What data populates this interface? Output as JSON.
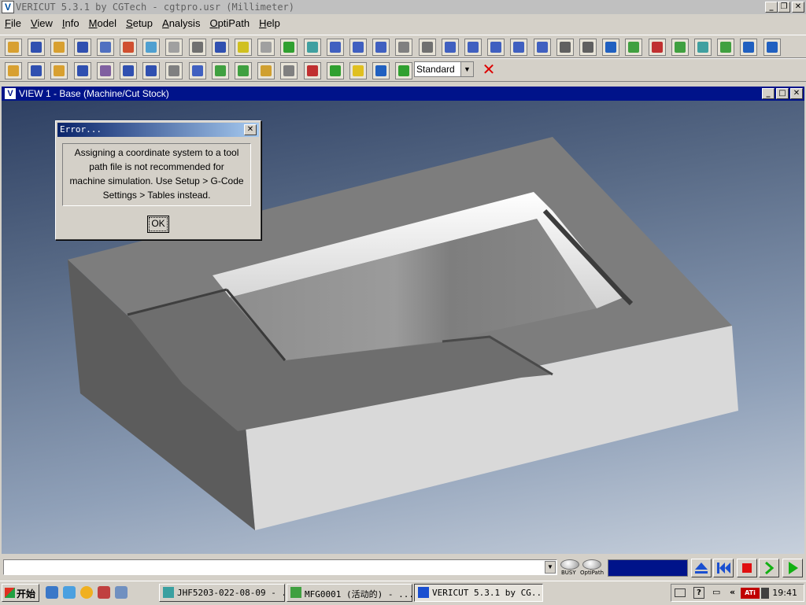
{
  "window": {
    "title": "VERICUT 5.3.1 by CGTech - cgtpro.usr (Millimeter)"
  },
  "menu": [
    {
      "pre": "",
      "u": "F",
      "post": "ile"
    },
    {
      "pre": "",
      "u": "V",
      "post": "iew"
    },
    {
      "pre": "",
      "u": "I",
      "post": "nfo"
    },
    {
      "pre": "",
      "u": "M",
      "post": "odel"
    },
    {
      "pre": "",
      "u": "S",
      "post": "etup"
    },
    {
      "pre": "",
      "u": "A",
      "post": "nalysis"
    },
    {
      "pre": "",
      "u": "O",
      "post": "ptiPath"
    },
    {
      "pre": "",
      "u": "H",
      "post": "elp"
    }
  ],
  "toolbar": {
    "mode_select": "Standard"
  },
  "view": {
    "title": "VIEW 1 - Base (Machine/Cut Stock)"
  },
  "dialog": {
    "title": "Error...",
    "message_lines": [
      "Assigning a coordinate system to a tool",
      "path file is not recommended for",
      "machine simulation. Use Setup > G-Code",
      "Settings > Tables instead."
    ],
    "ok_label": "OK"
  },
  "status": {
    "busy_label": "BUSY",
    "optipath_label": "OptiPath"
  },
  "taskbar": {
    "start_label": "开始",
    "tasks": [
      {
        "label": "JHF5203-022-08-09 - ...",
        "active": false
      },
      {
        "label": "MFG0001 (活动的) - ...",
        "active": false
      },
      {
        "label": "VERICUT 5.3.1 by CG...",
        "active": true
      }
    ],
    "clock": "19:41",
    "tray_ati": "ATi"
  },
  "colors": {
    "view_title_bg": "#00138a",
    "progress_fill": "#00138a",
    "dialog_title": "#0a246a"
  }
}
